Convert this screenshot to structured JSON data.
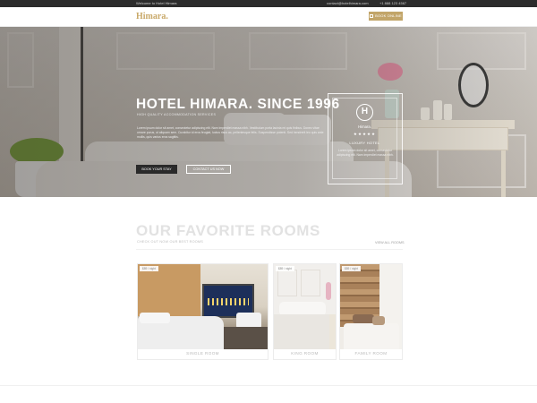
{
  "topbar": {
    "welcome": "Welcome to Hotel Himara",
    "email": "contact@hotelhimara.com",
    "phone": "+1 888 123 4567"
  },
  "header": {
    "logo": "Himara.",
    "book_label": "BOOK ONLINE"
  },
  "hero": {
    "title": "HOTEL HIMARA. SINCE 1996",
    "subtitle": "HIGH QUALITY ACCOMMODATION SERVICES",
    "text": "Lorem ipsum dolor sit amet, consectetur adipiscing elit. Nam imperdiet massa nibh. Vestibulum porta lacinia mi quis finibus. Donec vitae ornare purus, ut aliquam sem. Curabitur id eros feugiat, luctus risus ac, pellentesque felis. Suspendisse potenti. Sed hendrerit leo quis ante mollis, quis varius eros sagittis.",
    "book_stay_label": "BOOK YOUR STAY",
    "contact_label": "CONTACT US NOW",
    "badge": {
      "logo_letter": "H",
      "name": "Himara.",
      "stars": "★★★★★",
      "kind": "LUXURY HOTEL",
      "text": "Lorem ipsum dolor sit amet, consectetur adipiscing elit. Nam imperdiet massa nibh."
    }
  },
  "rooms": {
    "title": "OUR FAVORITE ROOMS",
    "subtitle": "CHECK OUT NOW OUR BEST ROOMS",
    "view_all": "VIEW ALL ROOMS",
    "cards": [
      {
        "price": "$89 / night",
        "label": "SINGLE ROOM"
      },
      {
        "price": "$89 / night",
        "label": "KING ROOM"
      },
      {
        "price": "$89 / night",
        "label": "FAMILY ROOM"
      }
    ]
  },
  "colors": {
    "accent": "#c2a569",
    "topbar": "#2c2c2c",
    "dark_button": "#2a2a2a"
  }
}
